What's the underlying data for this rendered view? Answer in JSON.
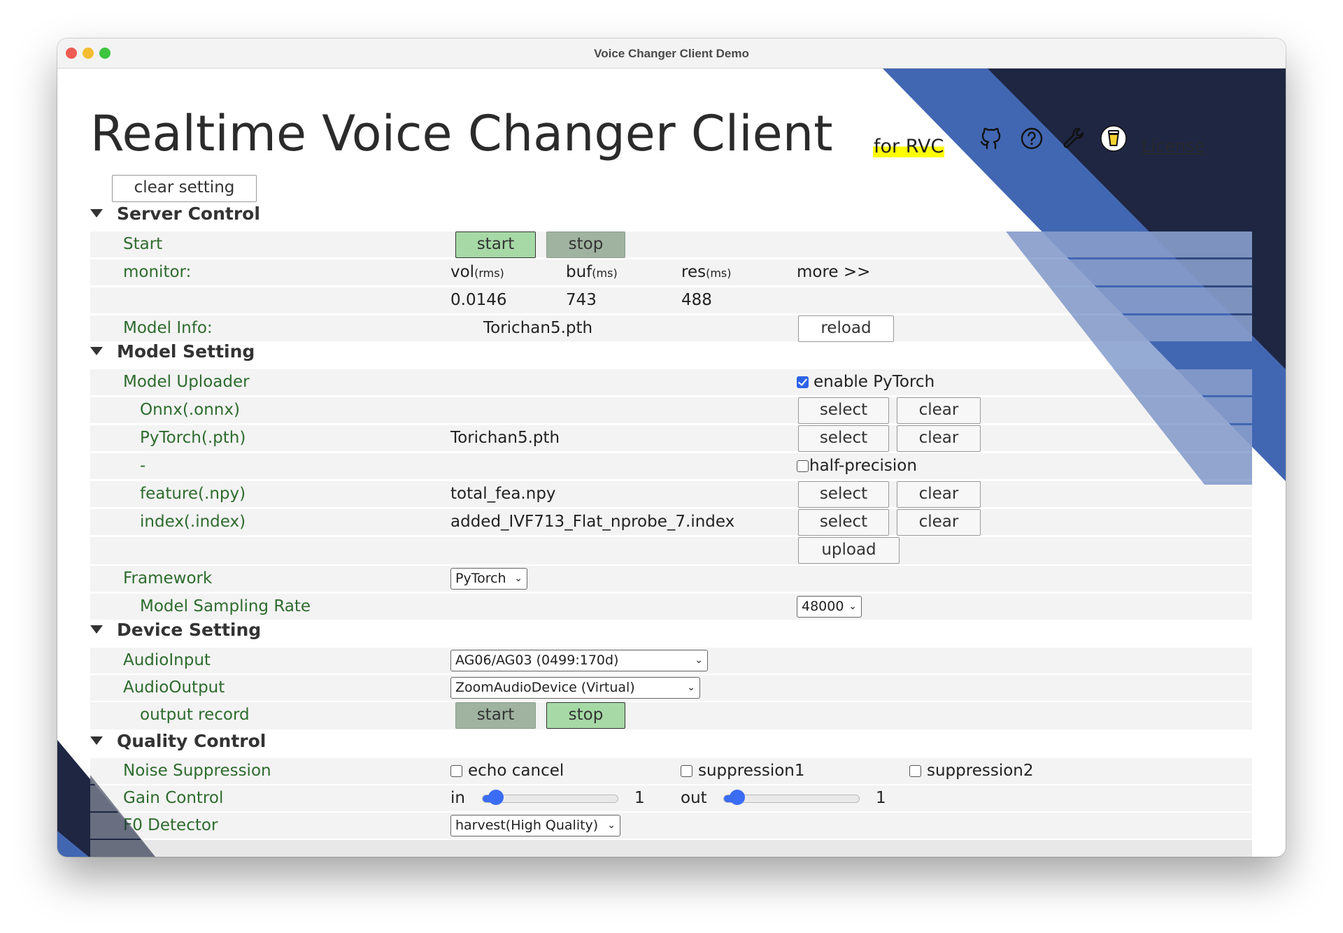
{
  "window": {
    "title": "Voice Changer Client Demo"
  },
  "header": {
    "title": "Realtime Voice Changer Client",
    "subtitle": "for RVC",
    "icons": [
      "github-icon",
      "help-icon",
      "wrench-icon",
      "coffee-cup-icon"
    ],
    "license_link": "License"
  },
  "clear_setting_label": "clear setting",
  "colors": {
    "accent_blue": "#4267b2",
    "navy": "#1e2642",
    "label_green": "#2e6b2e",
    "active_green": "#a6d9a6",
    "inactive_green": "#9fb3a0",
    "highlight_yellow": "#ffff00"
  },
  "server_control": {
    "heading": "Server Control",
    "start_label": "Start",
    "start_button": "start",
    "stop_button": "stop",
    "monitor_label": "monitor:",
    "vol_label": "vol",
    "vol_unit": "(rms)",
    "buf_label": "buf",
    "buf_unit": "(ms)",
    "res_label": "res",
    "res_unit": "(ms)",
    "more_link": "more >>",
    "vol_value": "0.0146",
    "buf_value": "743",
    "res_value": "488",
    "model_info_label": "Model Info:",
    "model_info_value": "Torichan5.pth",
    "reload_button": "reload"
  },
  "model_setting": {
    "heading": "Model Setting",
    "uploader_label": "Model Uploader",
    "enable_pytorch_label": "enable PyTorch",
    "enable_pytorch_checked": true,
    "onnx_label": "Onnx(.onnx)",
    "onnx_value": "",
    "pytorch_label": "PyTorch(.pth)",
    "pytorch_value": "Torichan5.pth",
    "dash_label": "-",
    "half_precision_label": "half-precision",
    "half_precision_checked": false,
    "feature_label": "feature(.npy)",
    "feature_value": "total_fea.npy",
    "index_label": "index(.index)",
    "index_value": "added_IVF713_Flat_nprobe_7.index",
    "select_button": "select",
    "clear_button": "clear",
    "upload_button": "upload",
    "framework_label": "Framework",
    "framework_value": "PyTorch",
    "sampling_rate_label": "Model Sampling Rate",
    "sampling_rate_value": "48000"
  },
  "device_setting": {
    "heading": "Device Setting",
    "audio_input_label": "AudioInput",
    "audio_input_value": "AG06/AG03 (0499:170d)",
    "audio_output_label": "AudioOutput",
    "audio_output_value": "ZoomAudioDevice (Virtual)",
    "output_record_label": "output record",
    "start_button": "start",
    "stop_button": "stop"
  },
  "quality_control": {
    "heading": "Quality Control",
    "noise_label": "Noise Suppression",
    "echo_cancel_label": "echo cancel",
    "suppression1_label": "suppression1",
    "suppression2_label": "suppression2",
    "gain_label": "Gain Control",
    "gain_in_label": "in",
    "gain_in_value": "1",
    "gain_in_fraction": 0.1,
    "gain_out_label": "out",
    "gain_out_value": "1",
    "gain_out_fraction": 0.1,
    "f0_label": "F0 Detector",
    "f0_value": "harvest(High Quality)"
  }
}
